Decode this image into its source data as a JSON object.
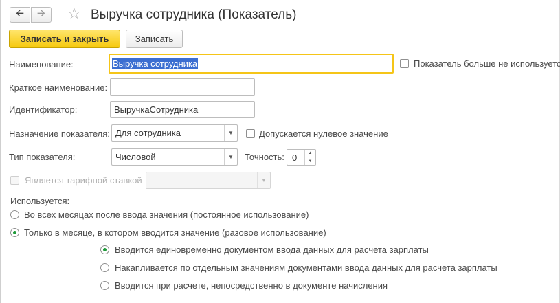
{
  "header": {
    "back_icon": "arrow-left-icon",
    "forward_icon": "arrow-right-icon",
    "favorite_icon": "star-icon",
    "title": "Выручка сотрудника (Показатель)"
  },
  "toolbar": {
    "save_close_label": "Записать и закрыть",
    "save_label": "Записать"
  },
  "form": {
    "name": {
      "label": "Наименование:",
      "value": "Выручка сотрудника"
    },
    "unused_checkbox": {
      "label": "Показатель больше не используется",
      "checked": false
    },
    "short_name": {
      "label": "Краткое наименование:",
      "value": ""
    },
    "identifier": {
      "label": "Идентификатор:",
      "value": "ВыручкаСотрудника"
    },
    "purpose": {
      "label": "Назначение показателя:",
      "value": "Для сотрудника"
    },
    "zero_allowed": {
      "label": "Допускается нулевое значение",
      "checked": false
    },
    "type": {
      "label": "Тип показателя:",
      "value": "Числовой"
    },
    "precision": {
      "label": "Точность:",
      "value": "0"
    },
    "tariff_rate": {
      "label": "Является тарифной ставкой",
      "checked": false,
      "disabled": true,
      "value": ""
    },
    "usage": {
      "label": "Используется:",
      "options": [
        {
          "label": "Во всех месяцах после ввода значения (постоянное использование)",
          "selected": false
        },
        {
          "label": "Только в месяце, в котором вводится значение (разовое использование)",
          "selected": true
        }
      ]
    },
    "input_mode": {
      "options": [
        {
          "label": "Вводится единовременно документом ввода данных для расчета зарплаты",
          "selected": true
        },
        {
          "label": "Накапливается по отдельным значениям документами ввода данных для расчета зарплаты",
          "selected": false
        },
        {
          "label": "Вводится при расчете, непосредственно в документе начисления",
          "selected": false
        }
      ]
    }
  },
  "colors": {
    "primary_button": "#f6c90e",
    "focus_border": "#f5c518",
    "selection": "#3b6ed1",
    "radio_dot": "#1f9a3a"
  }
}
